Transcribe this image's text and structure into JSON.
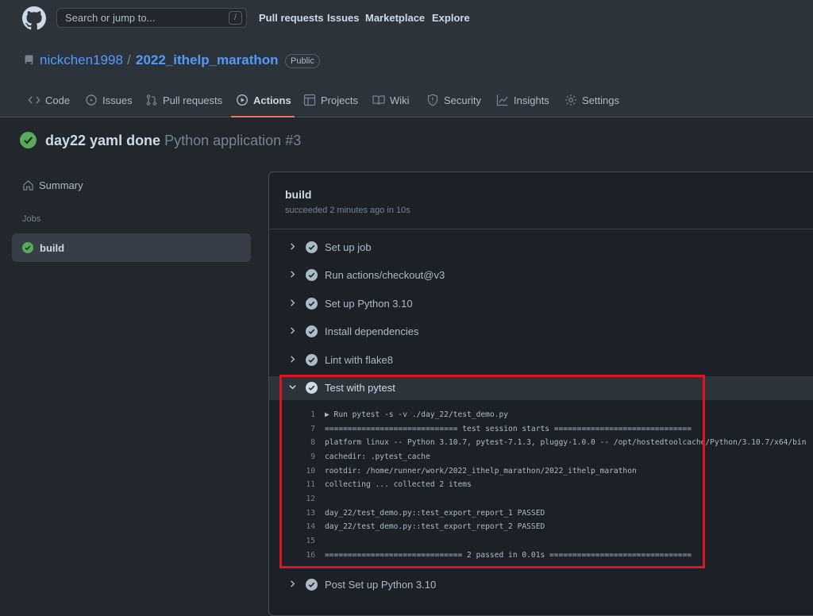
{
  "header": {
    "search_placeholder": "Search or jump to...",
    "search_shortcut": "/",
    "nav": [
      "Pull requests",
      "Issues",
      "Marketplace",
      "Explore"
    ]
  },
  "repo": {
    "owner": "nickchen1998",
    "separator": "/",
    "name": "2022_ithelp_marathon",
    "visibility": "Public"
  },
  "tabs": [
    {
      "label": "Code",
      "icon": "code-icon"
    },
    {
      "label": "Issues",
      "icon": "issue-icon"
    },
    {
      "label": "Pull requests",
      "icon": "pull-request-icon"
    },
    {
      "label": "Actions",
      "icon": "play-icon",
      "active": true
    },
    {
      "label": "Projects",
      "icon": "table-icon"
    },
    {
      "label": "Wiki",
      "icon": "book-icon"
    },
    {
      "label": "Security",
      "icon": "shield-icon"
    },
    {
      "label": "Insights",
      "icon": "graph-icon"
    },
    {
      "label": "Settings",
      "icon": "gear-icon"
    }
  ],
  "run": {
    "title": "day22 yaml done",
    "workflow": "Python application #3"
  },
  "sidebar": {
    "summary": "Summary",
    "jobs_heading": "Jobs",
    "job": "build"
  },
  "job": {
    "title": "build",
    "status": "succeeded 2 minutes ago in 10s",
    "steps": [
      "Set up job",
      "Run actions/checkout@v3",
      "Set up Python 3.10",
      "Install dependencies",
      "Lint with flake8",
      "Test with pytest",
      "Post Set up Python 3.10"
    ],
    "log": [
      {
        "n": "1",
        "t": "▶ Run pytest -s -v ./day_22/test_demo.py"
      },
      {
        "n": "7",
        "t": "============================= test session starts =============================="
      },
      {
        "n": "8",
        "t": "platform linux -- Python 3.10.7, pytest-7.1.3, pluggy-1.0.0 -- /opt/hostedtoolcache/Python/3.10.7/x64/bin"
      },
      {
        "n": "9",
        "t": "cachedir: .pytest_cache"
      },
      {
        "n": "10",
        "t": "rootdir: /home/runner/work/2022_ithelp_marathon/2022_ithelp_marathon"
      },
      {
        "n": "11",
        "t": "collecting ... collected 2 items"
      },
      {
        "n": "12",
        "t": ""
      },
      {
        "n": "13",
        "t": "day_22/test_demo.py::test_export_report_1 PASSED"
      },
      {
        "n": "14",
        "t": "day_22/test_demo.py::test_export_report_2 PASSED"
      },
      {
        "n": "15",
        "t": ""
      },
      {
        "n": "16",
        "t": "============================== 2 passed in 0.01s ==============================="
      }
    ]
  },
  "colors": {
    "success": "#57ab5a",
    "accent": "#539bf5",
    "highlight": "#e0141e"
  }
}
